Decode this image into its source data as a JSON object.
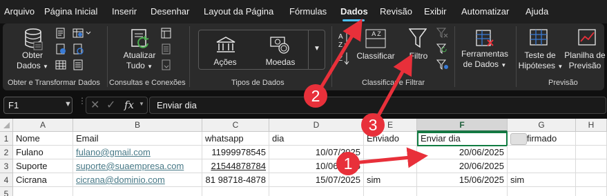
{
  "menu": {
    "tabs": [
      "Arquivo",
      "Página Inicial",
      "Inserir",
      "Desenhar",
      "Layout da Página",
      "Fórmulas",
      "Dados",
      "Revisão",
      "Exibir",
      "Automatizar",
      "Ajuda"
    ],
    "active_tab": "Dados"
  },
  "ribbon": {
    "groups": {
      "get_transform": "Obter e Transformar Dados",
      "queries": "Consultas e Conexões",
      "data_types": "Tipos de Dados",
      "sort_filter": "Classificar e Filtrar",
      "forecast": "Previsão"
    },
    "buttons": {
      "get_data_1": "Obter",
      "get_data_2": "Dados",
      "refresh_1": "Atualizar",
      "refresh_2": "Tudo",
      "stocks": "Ações",
      "currencies": "Moedas",
      "sort": "Classificar",
      "filter": "Filtro",
      "data_tools_1": "Ferramentas",
      "data_tools_2": "de Dados",
      "what_if_1": "Teste de",
      "what_if_2": "Hipóteses",
      "forecast_sheet_1": "Planilha de",
      "forecast_sheet_2": "Previsão"
    },
    "sort_icon_text": "A Z"
  },
  "formula_bar": {
    "name_box": "F1",
    "content": "Enviar dia"
  },
  "sheet": {
    "columns": [
      "A",
      "B",
      "C",
      "D",
      "E",
      "F",
      "G",
      "H"
    ],
    "selected_column": "F",
    "row_numbers": [
      "1",
      "2",
      "3",
      "4",
      "5"
    ],
    "rows": [
      [
        "Nome",
        "Email",
        "whatsapp",
        "dia",
        "Enviado",
        "Enviar dia",
        "Confirmado",
        ""
      ],
      [
        "Fulano",
        "fulano@gmail.com",
        "11999978545",
        "10/07/2025",
        "",
        "20/06/2025",
        "",
        ""
      ],
      [
        "Suporte",
        "suporte@suaempresa.com",
        "21544878784",
        "10/06/2025",
        "",
        "20/06/2025",
        "",
        ""
      ],
      [
        "Cicrana",
        "cicrana@dominio.com",
        "81 98718-4878",
        "15/07/2025",
        "sim",
        "15/06/2025",
        "sim",
        ""
      ]
    ]
  },
  "annotations": {
    "badges": [
      "1",
      "2",
      "3"
    ],
    "color": "#e8303a"
  }
}
